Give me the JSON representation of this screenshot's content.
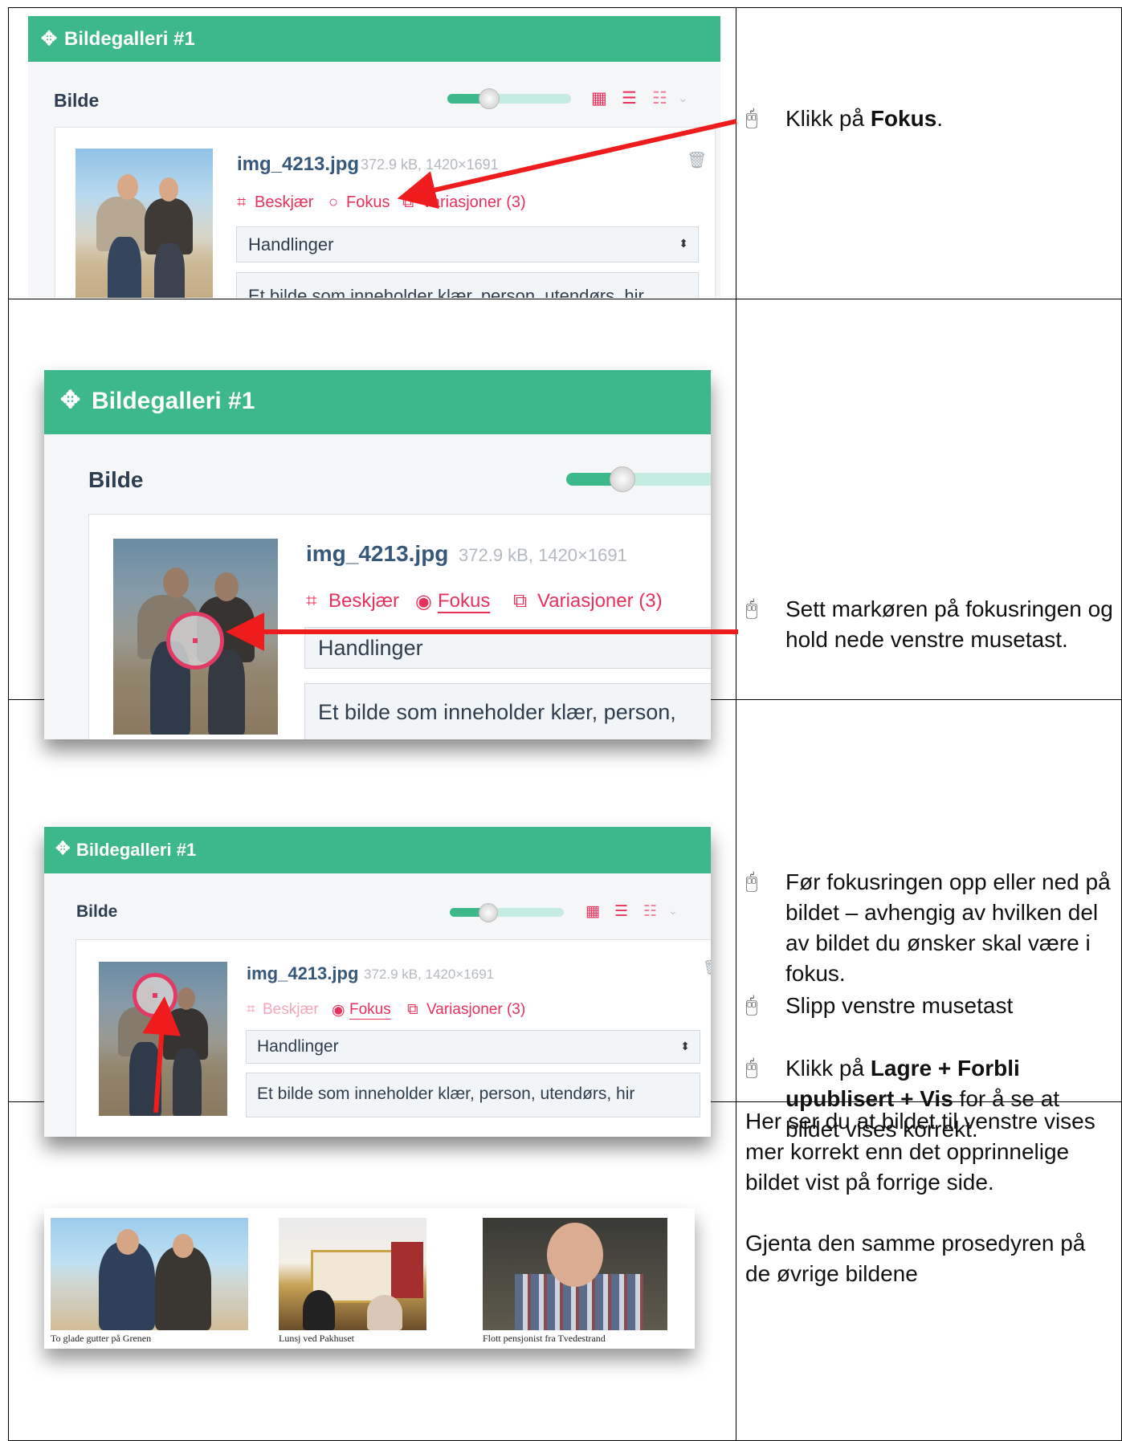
{
  "panel": {
    "title": "Bildegalleri #1",
    "section_label": "Bilde",
    "file_name": "img_4213.jpg",
    "file_meta": "372.9 kB, 1420×1691",
    "link_crop": "Beskjær",
    "link_focus": "Fokus",
    "link_variations": "Variasjoner (3)",
    "select_value": "Handlinger",
    "alt_text": "Et bilde som inneholder klær, person, utendørs, hir",
    "alt_text_row2": "Et bilde som inneholder klær, person,",
    "colors": {
      "header": "#3cb88a",
      "accent": "#e8315b",
      "filename": "#36587a"
    },
    "icons": [
      "move-icon",
      "grid-view-icon",
      "list-view-icon",
      "details-view-icon",
      "chevron-down-icon",
      "trash-icon",
      "crop-icon",
      "focus-circle-icon",
      "variations-icon"
    ]
  },
  "steps": {
    "row1": {
      "text_before": "Klikk på ",
      "bold": "Fokus",
      "text_after": "."
    },
    "row2": {
      "text": "Sett markøren på fokusringen og hold nede venstre musetast."
    },
    "row3": {
      "item1": "Før fokusringen opp eller ned på bildet – avhengig av hvilken del av bildet du ønsker skal være i fokus.",
      "item2": "Slipp venstre musetast",
      "item3_before": "Klikk på ",
      "item3_bold": "Lagre + Forbli upublisert + Vis",
      "item3_after": " for å se at bildet vises korrekt."
    },
    "row4": {
      "para1": "Her ser du at bildet til venstre vises mer korrekt enn det opprinnelige bildet vist på forrige side.",
      "para2": "Gjenta den samme prosedyren på de øvrige bildene"
    }
  },
  "gallery": {
    "captions": [
      "To glade gutter på Grenen",
      "Lunsj ved Pakhuset",
      "Flott pensjonist fra Tvedestrand"
    ]
  }
}
